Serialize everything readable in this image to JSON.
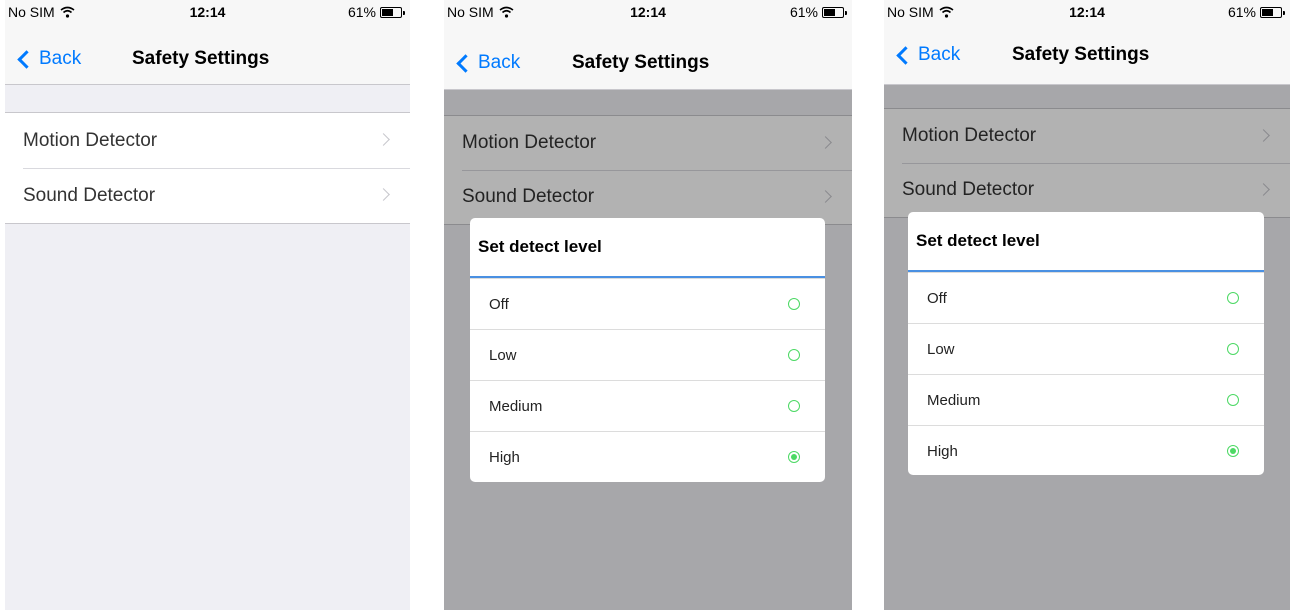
{
  "status": {
    "carrier": "No SIM",
    "time": "12:14",
    "battery": "61%",
    "battery_level": 0.61
  },
  "nav": {
    "back_label": "Back",
    "title": "Safety Settings"
  },
  "settings": {
    "items": [
      {
        "label": "Motion Detector"
      },
      {
        "label": "Sound Detector"
      }
    ]
  },
  "dialog": {
    "title": "Set detect level",
    "options": [
      {
        "label": "Off",
        "selected": false
      },
      {
        "label": "Low",
        "selected": false
      },
      {
        "label": "Medium",
        "selected": false
      },
      {
        "label": "High",
        "selected": true
      }
    ]
  },
  "colors": {
    "accent": "#007aff",
    "radio": "#4cd964",
    "dialog_divider": "#4a90e2"
  }
}
